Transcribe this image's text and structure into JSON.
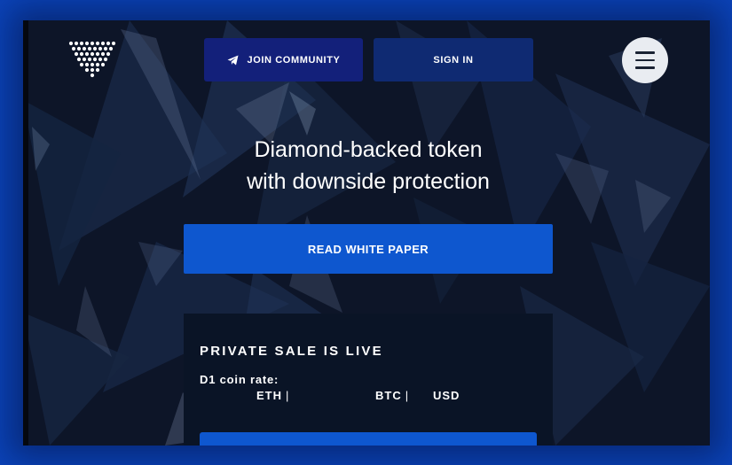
{
  "header": {
    "logo_icon": "diamond-dots-logo",
    "join_community_label": "JOIN COMMUNITY",
    "join_community_icon": "telegram-icon",
    "sign_in_label": "SIGN IN",
    "menu_icon": "hamburger-menu-icon"
  },
  "hero": {
    "headline_line1": "Diamond-backed token",
    "headline_line2": "with downside protection",
    "white_paper_label": "READ WHITE PAPER"
  },
  "sale": {
    "title": "PRIVATE SALE IS LIVE",
    "rate_label": "D1 coin rate:",
    "eth_label": "ETH",
    "btc_label": "BTC",
    "usd_label": "USD",
    "separator": "|"
  },
  "colors": {
    "page_background": "#0b43b8",
    "hero_background": "#0d1528",
    "community_button": "#13207a",
    "signin_button": "#0f2a72",
    "primary_button": "#0e57cf",
    "panel": "#0a1426"
  }
}
